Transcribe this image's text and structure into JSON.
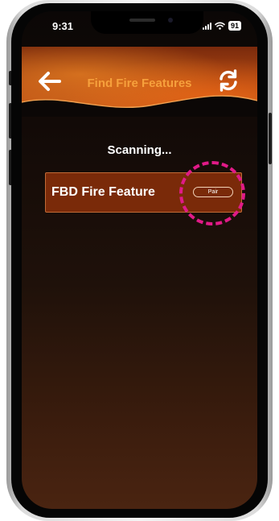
{
  "status_bar": {
    "time": "9:31",
    "battery": "91"
  },
  "header": {
    "title": "Find Fire Features",
    "back_icon": "arrow-left-icon",
    "refresh_icon": "refresh-icon"
  },
  "scan": {
    "status": "Scanning..."
  },
  "devices": [
    {
      "name": "FBD Fire Feature",
      "action_label": "Pair"
    }
  ],
  "colors": {
    "title_accent": "#f6a03c",
    "card_background": "#7a2a09",
    "card_border": "#c26a36",
    "highlight": "#e11a88",
    "screen_background": "#120a07"
  }
}
